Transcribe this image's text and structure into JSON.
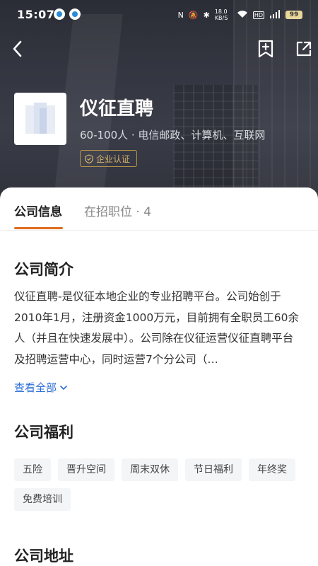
{
  "status_bar": {
    "time": "15:07",
    "speed": "18.0 KB/S",
    "battery": "99"
  },
  "company": {
    "name": "仪征直聘",
    "meta": "60-100人 · 电信邮政、计算机、互联网",
    "verify_label": "企业认证"
  },
  "tabs": [
    {
      "label": "公司信息",
      "active": true
    },
    {
      "label": "在招职位 · 4",
      "active": false
    }
  ],
  "intro": {
    "title": "公司简介",
    "text": "仪征直聘-是仪征本地企业的专业招聘平台。公司始创于2010年1月，注册资金1000万元，目前拥有全职员工60余人（并且在快速发展中）。公司除在仪征运营仪征直聘平台及招聘运营中心，同时运营7个分公司（…",
    "expand_label": "查看全部"
  },
  "benefits": {
    "title": "公司福利",
    "tags": [
      "五险",
      "晋升空间",
      "周末双休",
      "节日福利",
      "年终奖",
      "免费培训"
    ]
  },
  "address": {
    "title": "公司地址"
  },
  "colors": {
    "accent": "#e06d1f",
    "link": "#2e6fd6",
    "verify": "#d9b36b"
  },
  "icons": {
    "back": "chevron-left-icon",
    "bookmark": "bookmark-add-icon",
    "share": "share-icon",
    "verify": "shield-check-icon",
    "expand": "chevron-down-icon"
  }
}
